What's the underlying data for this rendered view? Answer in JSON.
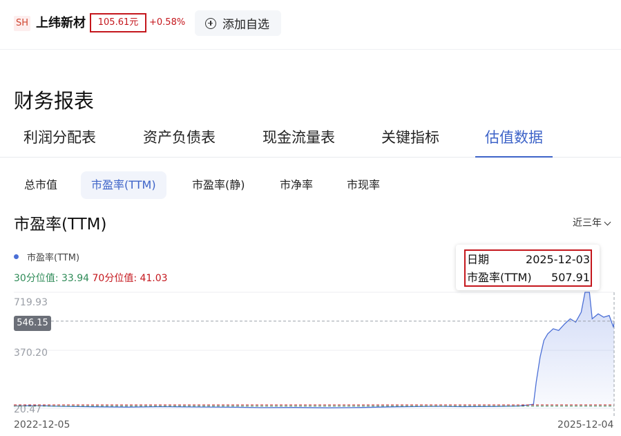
{
  "header": {
    "market": "SH",
    "stock_name": "上纬新材",
    "price": "105.61元",
    "change": "+0.58%",
    "add_watchlist": "添加自选"
  },
  "section_title": "财务报表",
  "tabs": [
    {
      "label": "利润分配表",
      "active": false
    },
    {
      "label": "资产负债表",
      "active": false
    },
    {
      "label": "现金流量表",
      "active": false
    },
    {
      "label": "关键指标",
      "active": false
    },
    {
      "label": "估值数据",
      "active": true
    }
  ],
  "subtabs": [
    {
      "label": "总市值",
      "active": false
    },
    {
      "label": "市盈率(TTM)",
      "active": true
    },
    {
      "label": "市盈率(静)",
      "active": false
    },
    {
      "label": "市净率",
      "active": false
    },
    {
      "label": "市现率",
      "active": false
    }
  ],
  "chart_title": "市盈率(TTM)",
  "range_selector": "近三年",
  "legend": "市盈率(TTM)",
  "percentiles": {
    "p30_label": "30分位值: 33.94",
    "p70_label": "70分位值: 41.03"
  },
  "tooltip": {
    "date_label": "日期",
    "date_value": "2025-12-03",
    "metric_label": "市盈率(TTM)",
    "metric_value": "507.91"
  },
  "colors": {
    "accent": "#3d63c8",
    "up": "#c4161c",
    "down": "#2e8b57",
    "line": "#4b6fd6"
  },
  "chart_data": {
    "type": "area",
    "title": "市盈率(TTM)",
    "xlabel": "",
    "ylabel": "",
    "x_range": [
      "2022-12-05",
      "2025-12-04"
    ],
    "yticks": [
      "719.93",
      "370.20",
      "20.47"
    ],
    "ylim": [
      20.47,
      719.93
    ],
    "y_crosshair": "546.15",
    "reference_lines": [
      33.94,
      41.03
    ],
    "grid": true,
    "series": [
      {
        "name": "市盈率(TTM)",
        "points": [
          [
            "2022-12-05",
            35
          ],
          [
            "2023-01-15",
            37
          ],
          [
            "2023-03-01",
            33
          ],
          [
            "2023-05-01",
            30
          ],
          [
            "2023-07-01",
            28
          ],
          [
            "2023-09-01",
            31
          ],
          [
            "2023-11-01",
            29
          ],
          [
            "2024-01-15",
            27
          ],
          [
            "2024-03-01",
            25
          ],
          [
            "2024-05-01",
            26
          ],
          [
            "2024-07-01",
            24
          ],
          [
            "2024-09-01",
            26
          ],
          [
            "2024-11-01",
            30
          ],
          [
            "2025-01-15",
            33
          ],
          [
            "2025-03-01",
            31
          ],
          [
            "2025-05-01",
            32
          ],
          [
            "2025-06-15",
            35
          ],
          [
            "2025-07-10",
            45
          ],
          [
            "2025-07-15",
            180
          ],
          [
            "2025-07-22",
            330
          ],
          [
            "2025-07-29",
            430
          ],
          [
            "2025-08-05",
            470
          ],
          [
            "2025-08-15",
            500
          ],
          [
            "2025-08-25",
            490
          ],
          [
            "2025-09-05",
            530
          ],
          [
            "2025-09-15",
            560
          ],
          [
            "2025-09-25",
            540
          ],
          [
            "2025-10-05",
            600
          ],
          [
            "2025-10-12",
            720
          ],
          [
            "2025-10-20",
            720
          ],
          [
            "2025-10-25",
            560
          ],
          [
            "2025-11-05",
            590
          ],
          [
            "2025-11-15",
            570
          ],
          [
            "2025-11-25",
            580
          ],
          [
            "2025-12-03",
            507.91
          ],
          [
            "2025-12-04",
            546
          ]
        ]
      }
    ]
  }
}
